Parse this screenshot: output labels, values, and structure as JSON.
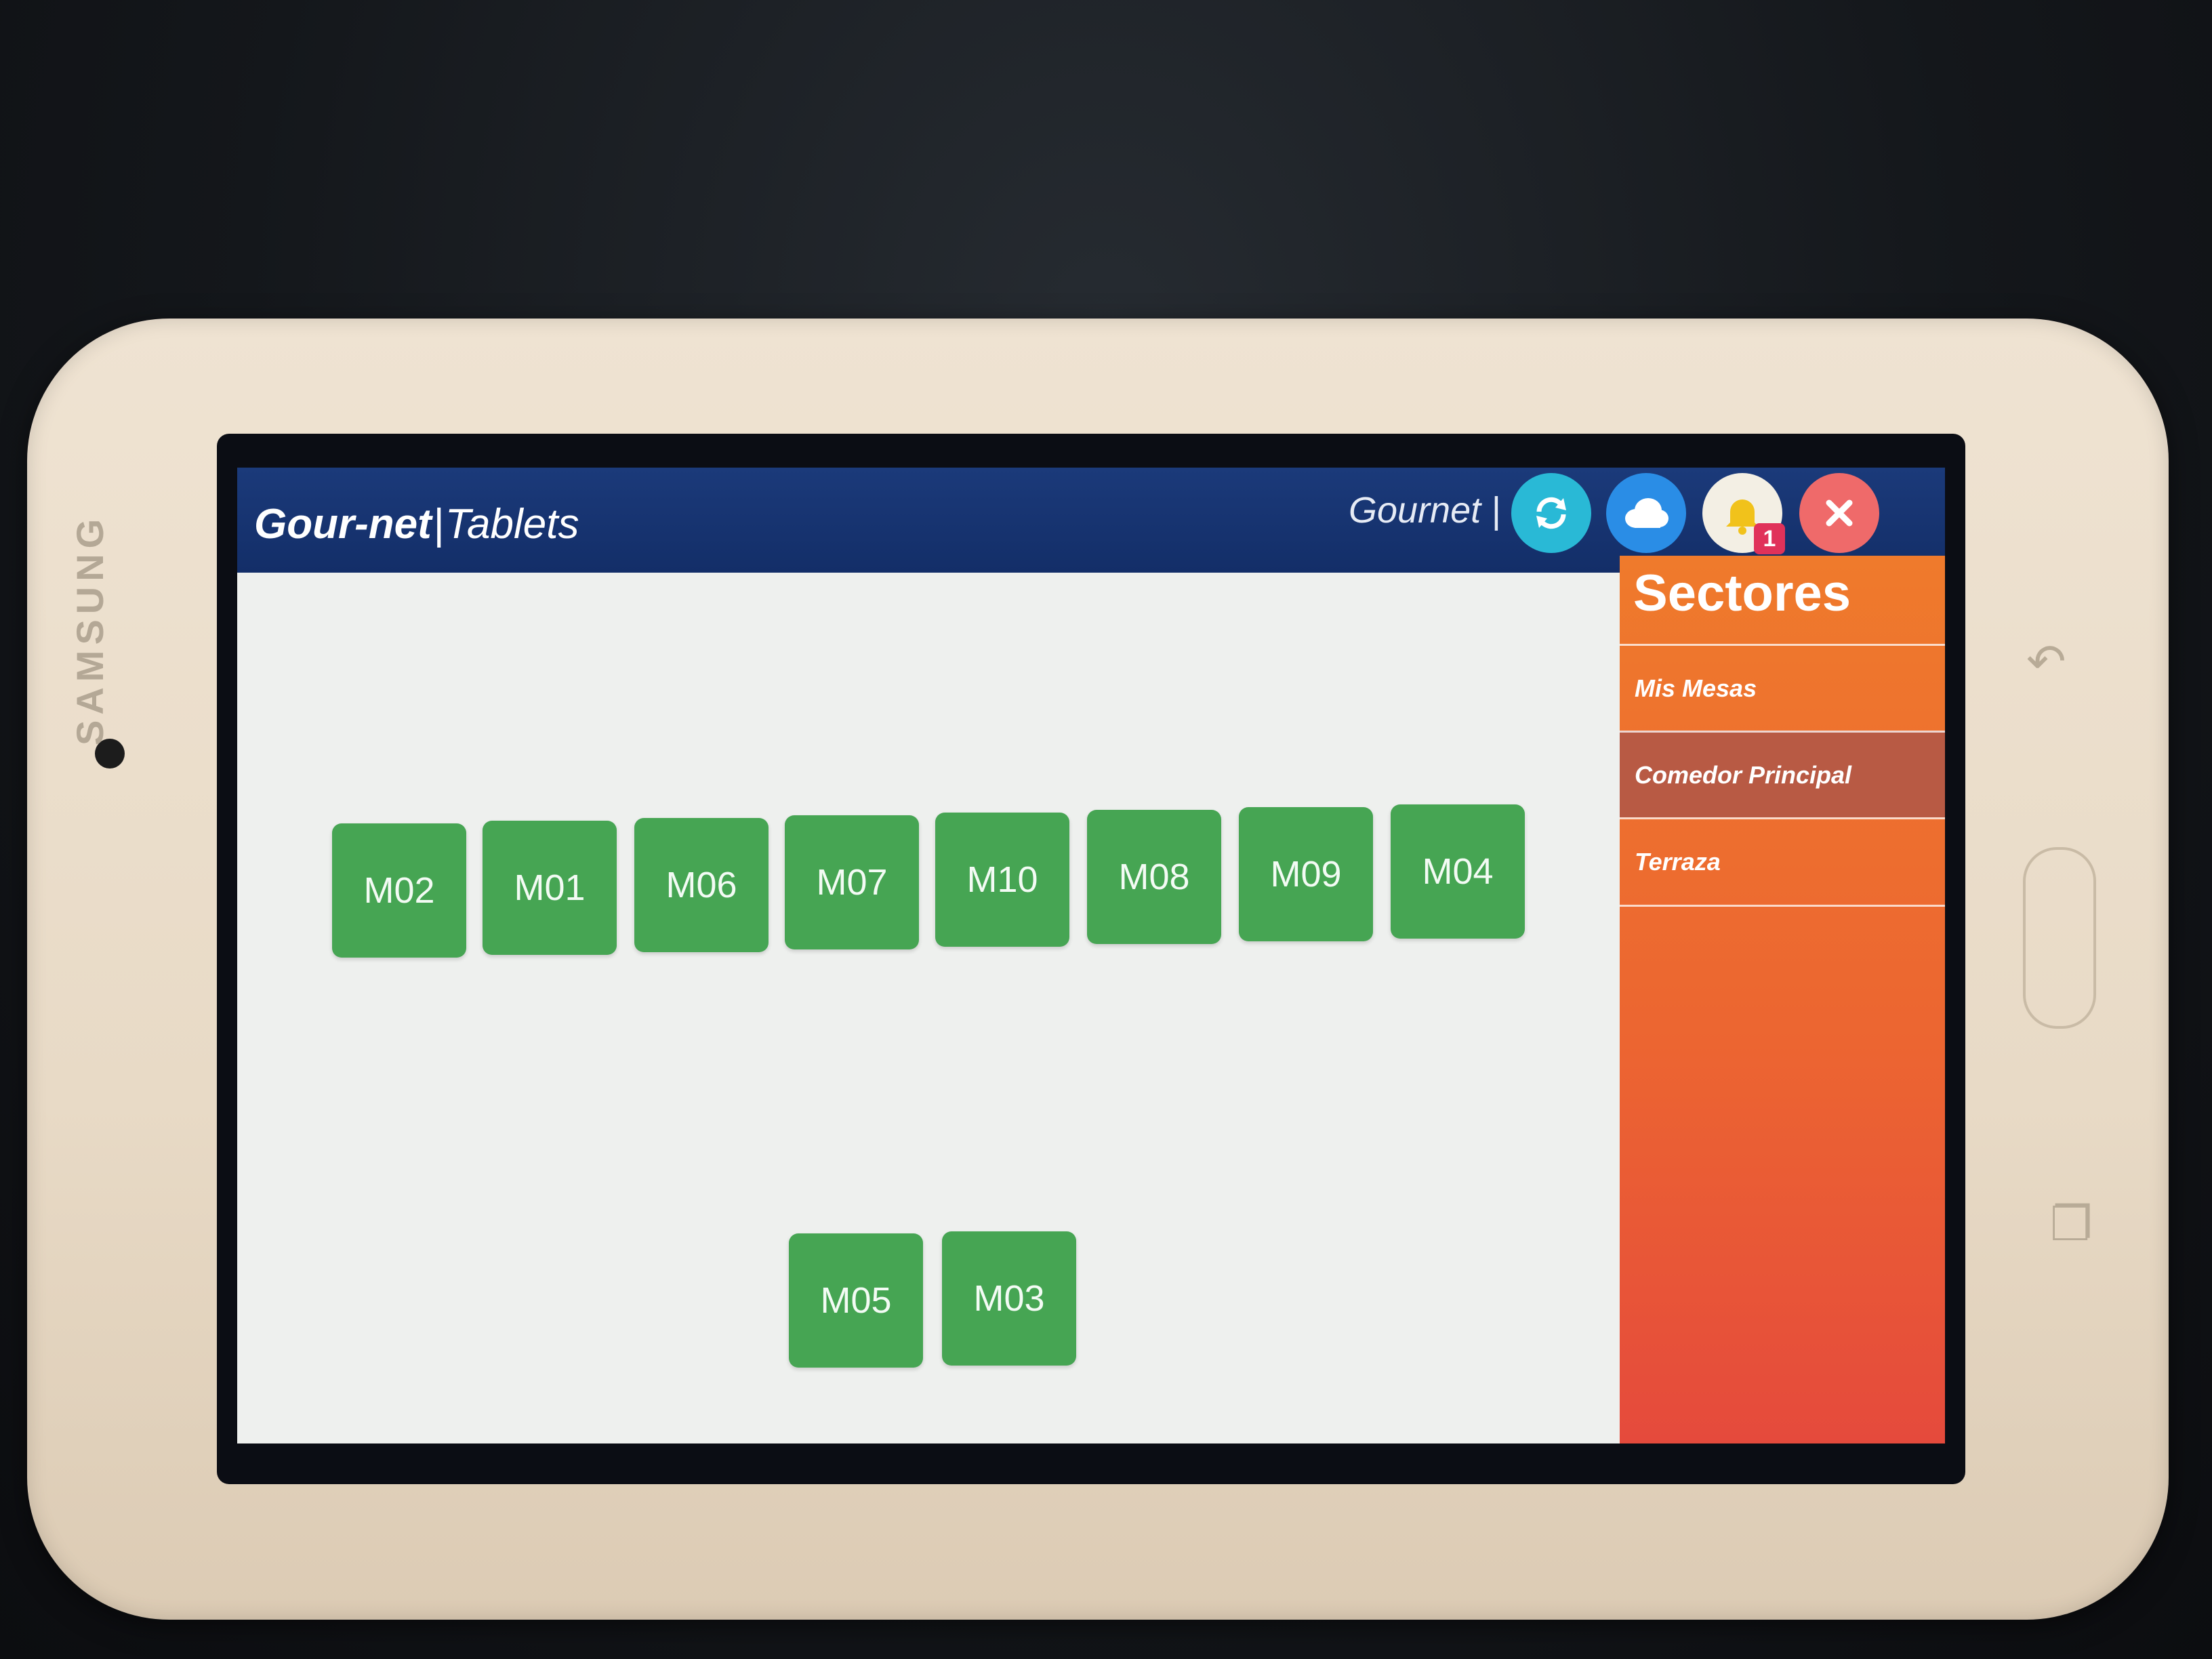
{
  "device": {
    "brand": "SAMSUNG"
  },
  "header": {
    "logo_bold": "Gour-net",
    "logo_sep": "|",
    "logo_rest": "Tablets",
    "user": "Gournet |",
    "notifications_count": "1",
    "icons": [
      "sync-icon",
      "cloud-icon",
      "bell-icon",
      "close-icon"
    ]
  },
  "floor": {
    "tables": [
      "M02",
      "M01",
      "M06",
      "M07",
      "M10",
      "M08",
      "M09",
      "M04",
      "M05",
      "M03"
    ]
  },
  "sidebar": {
    "title": "Sectores",
    "sectors": [
      "Mis Mesas",
      "Comedor Principal",
      "Terraza"
    ],
    "active_sector": "Comedor Principal"
  },
  "colors": {
    "header_bg": "#1b3a7a",
    "table_green": "#46a553",
    "sidebar_orange": "#ef7a2c",
    "sync_btn": "#29b9d6",
    "cloud_btn": "#2a8de6",
    "close_btn": "#ef6a6a"
  }
}
